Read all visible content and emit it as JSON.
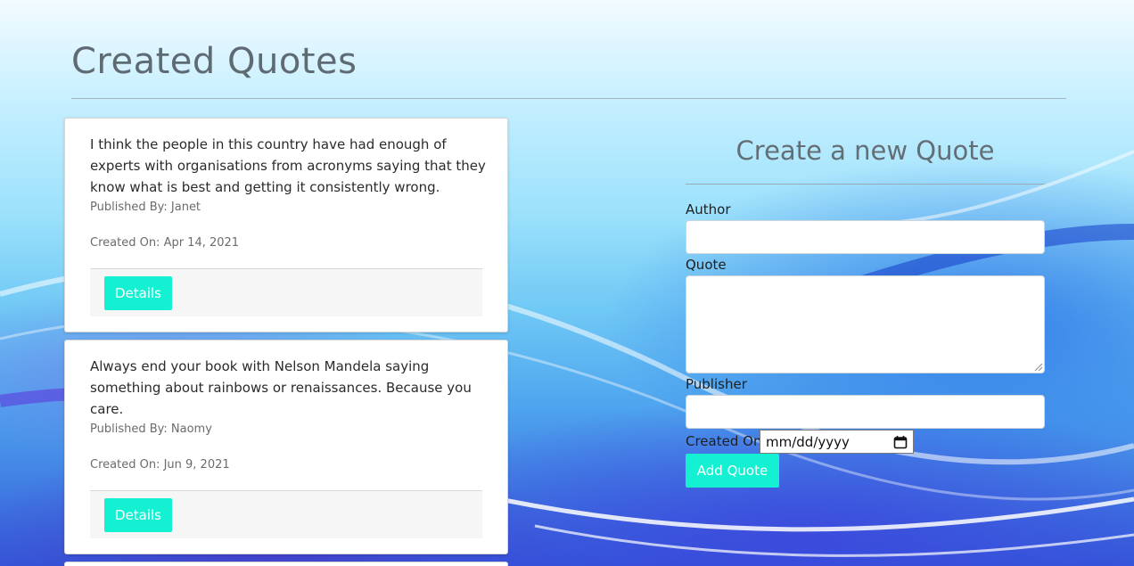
{
  "page": {
    "title": "Created Quotes"
  },
  "quotes": [
    {
      "text": "I think the people in this country have had enough of experts with organisations from acronyms saying that they know what is best and getting it consistently wrong.",
      "published_by": "Published By: Janet",
      "created_on": "Created On: Apr 14, 2021",
      "details_label": "Details"
    },
    {
      "text": "Always end your book with Nelson Mandela saying something about rainbows or renaissances. Because you care.",
      "published_by": "Published By: Naomy",
      "created_on": "Created On: Jun 9, 2021",
      "details_label": "Details"
    }
  ],
  "form": {
    "title": "Create a new Quote",
    "author_label": "Author",
    "author_value": "",
    "quote_label": "Quote",
    "quote_value": "",
    "publisher_label": "Publisher",
    "publisher_value": "",
    "created_on_label": "Created On",
    "created_on_placeholder": "mm/dd/yyyy",
    "submit_label": "Add Quote"
  },
  "icons": {
    "date_picker": "calendar-icon",
    "textarea_resize": "resize-grip-icon"
  },
  "colors": {
    "accent": "#14f0d2",
    "heading": "#5f6b73",
    "background_top": "#f2fbff",
    "background_bottom": "#3357d9"
  }
}
